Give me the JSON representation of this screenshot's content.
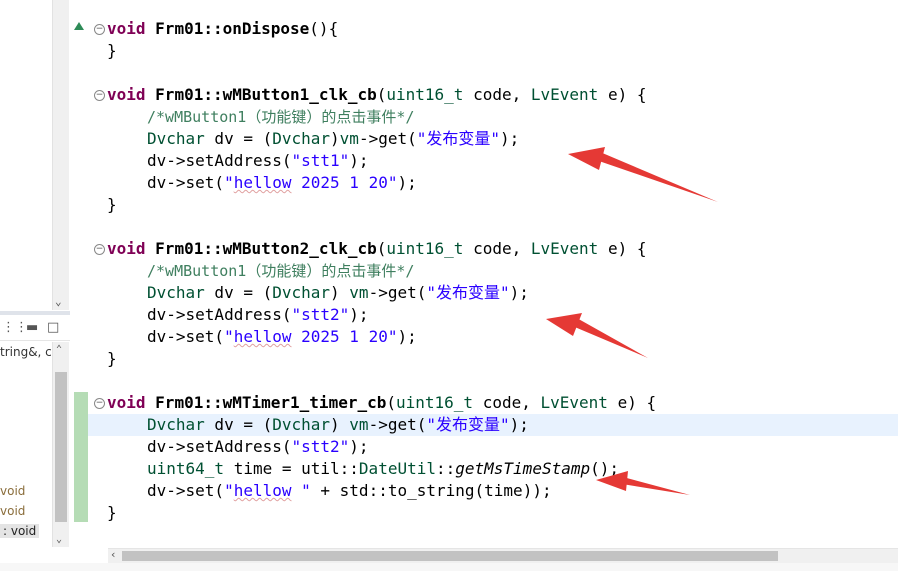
{
  "colors": {
    "keyword": "#7f0055",
    "type": "#005032",
    "string": "#2a00ff",
    "comment": "#3f7f5f",
    "annotation_arrow": "#e53935",
    "current_line": "#e8f2fe"
  },
  "outline": {
    "partial_item": "tring&, cc",
    "items": [
      {
        "type": "void"
      },
      {
        "type": "void"
      },
      {
        "type": ": void",
        "selected": true
      }
    ]
  },
  "code": {
    "l1": {
      "kw": "void",
      "fn": "Frm01::onDispose",
      "tail": "(){"
    },
    "l2": "}",
    "l4": {
      "kw": "void",
      "fn": "Frm01::wMButton1_clk_cb",
      "p1": "(",
      "ty1": "uint16_t",
      "p2": " code, ",
      "ty2": "LvEvent",
      "p3": " e) {"
    },
    "l5": "/*wMButton1（功能键）的点击事件*/",
    "l6": {
      "ty1": "Dvchar",
      "a": " dv = (",
      "ty2": "Dvchar",
      "b": ")",
      "ty3": "vm",
      "c": "->get(",
      "s": "\"发布变量\"",
      "d": ");"
    },
    "l7": {
      "a": "dv->setAddress(",
      "s": "\"stt1\"",
      "b": ");"
    },
    "l8": {
      "a": "dv->set(",
      "q1": "\"",
      "sq": "hellow",
      "s2": " 2025 1 20\"",
      "b": ");"
    },
    "l9": "}",
    "l11": {
      "kw": "void",
      "fn": "Frm01::wMButton2_clk_cb",
      "p1": "(",
      "ty1": "uint16_t",
      "p2": " code, ",
      "ty2": "LvEvent",
      "p3": " e) {"
    },
    "l12": "/*wMButton1（功能键）的点击事件*/",
    "l13": {
      "ty1": "Dvchar",
      "a": " dv = (",
      "ty2": "Dvchar",
      "b": ") ",
      "ty3": "vm",
      "c": "->get(",
      "s": "\"发布变量\"",
      "d": ");"
    },
    "l14": {
      "a": "dv->setAddress(",
      "s": "\"stt2\"",
      "b": ");"
    },
    "l15": {
      "a": "dv->set(",
      "q1": "\"",
      "sq": "hellow",
      "s2": " 2025 1 20\"",
      "b": ");"
    },
    "l16": "}",
    "l18": {
      "kw": "void",
      "fn": "Frm01::wMTimer1_timer_cb",
      "p1": "(",
      "ty1": "uint16_t",
      "p2": " code, ",
      "ty2": "LvEvent",
      "p3": " e) {"
    },
    "l19": {
      "ty1": "Dvchar",
      "a": " dv = (",
      "ty2": "Dvchar",
      "b": ") ",
      "ty3": "vm",
      "c": "->get(",
      "s": "\"发布变量\"",
      "d": ");"
    },
    "l20": {
      "a": "dv->setAddress(",
      "s": "\"stt2\"",
      "b": ");"
    },
    "l21": {
      "ty1": "uint64_t",
      "a": " time = util::",
      "ty2": "DateUtil",
      "b": "::",
      "st": "getMsTimeStamp",
      "c": "();"
    },
    "l22": {
      "a": "dv->set(",
      "q1": "\"",
      "sq": "hellow",
      "s2": " \"",
      "b": " + std::to_string(time));"
    },
    "l23": "}"
  }
}
